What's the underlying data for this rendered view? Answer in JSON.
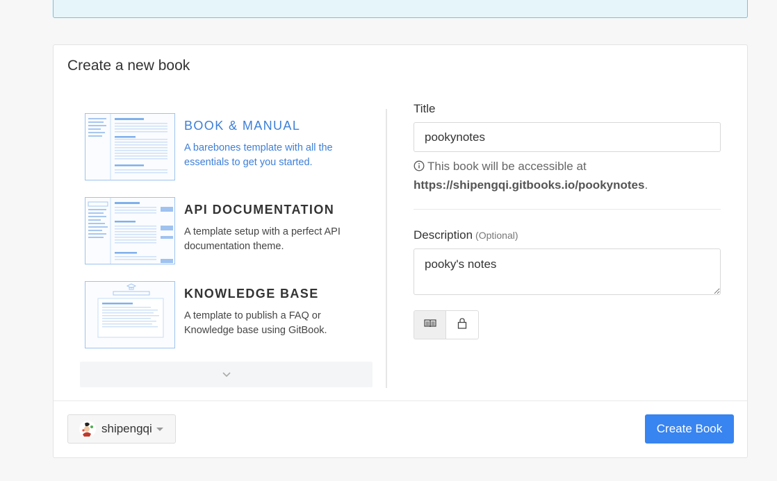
{
  "panel": {
    "title": "Create a new book"
  },
  "templates": [
    {
      "name": "BOOK & MANUAL",
      "description": "A barebones template with all the essentials to get you started.",
      "selected": true
    },
    {
      "name": "API DOCUMENTATION",
      "description": "A template setup with a perfect API documentation theme.",
      "selected": false
    },
    {
      "name": "KNOWLEDGE BASE",
      "description": "A template to publish a FAQ or Knowledge base using GitBook.",
      "selected": false
    }
  ],
  "form": {
    "title_label": "Title",
    "title_value": "pookynotes",
    "help_prefix": "This book will be accessible at",
    "help_url": "https://shipengqi.gitbooks.io/pookynotes",
    "help_suffix": ".",
    "description_label": "Description",
    "description_optional": "(Optional)",
    "description_value": "pooky's notes",
    "visibility_options": [
      {
        "icon": "book-icon",
        "active": true
      },
      {
        "icon": "lock-icon",
        "active": false
      }
    ]
  },
  "footer": {
    "owner_name": "shipengqi",
    "create_label": "Create Book"
  },
  "colors": {
    "accent": "#3d7fd8",
    "primary_button": "#3884f0"
  },
  "icons": [
    "chevron-down-icon",
    "info-icon",
    "book-icon",
    "lock-icon",
    "avatar",
    "caret-down-icon"
  ]
}
